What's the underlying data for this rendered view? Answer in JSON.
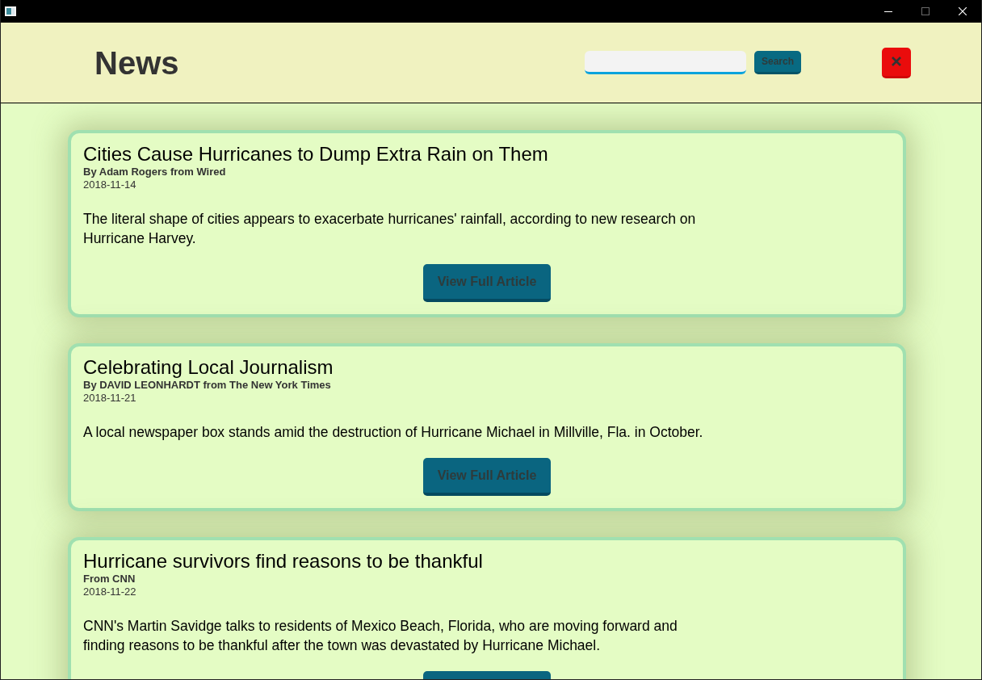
{
  "header": {
    "title": "News",
    "search_button": "Search"
  },
  "articles": [
    {
      "title": "Cities Cause Hurricanes to Dump Extra Rain on Them",
      "byline": "By Adam Rogers from Wired",
      "date": "2018-11-14",
      "summary": "The literal shape of cities appears to exacerbate hurricanes' rainfall, according to new research on Hurricane Harvey.",
      "button": "View Full Article"
    },
    {
      "title": "Celebrating Local Journalism",
      "byline": "By DAVID LEONHARDT from The New York Times",
      "date": "2018-11-21",
      "summary": "A local newspaper box stands amid the destruction of Hurricane Michael in Millville, Fla. in October.",
      "button": "View Full Article"
    },
    {
      "title": "Hurricane survivors find reasons to be thankful",
      "byline": "From CNN",
      "date": "2018-11-22",
      "summary": "CNN's Martin Savidge talks to residents of Mexico Beach, Florida, who are moving forward and finding reasons to be thankful after the town was devastated by Hurricane Michael."
    }
  ]
}
